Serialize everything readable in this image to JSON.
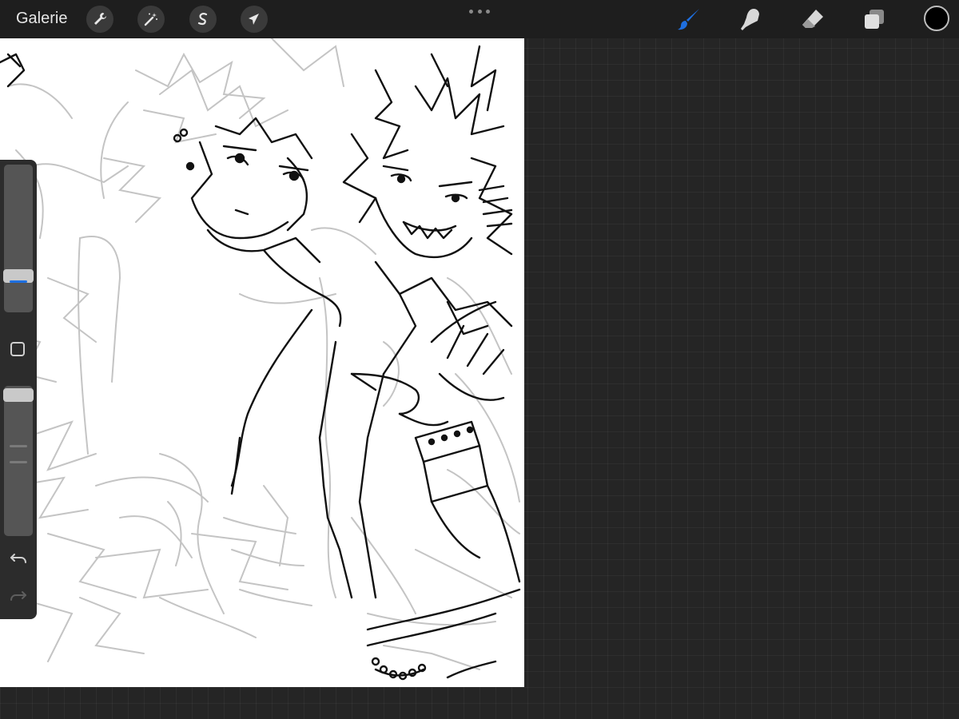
{
  "app": {
    "gallery_label": "Galerie"
  },
  "icons": {
    "actions": "wrench-icon",
    "adjustments": "magic-wand-icon",
    "selection": "selection-s-icon",
    "transform": "arrow-cursor-icon",
    "brush": "brush-icon",
    "smudge": "smudge-finger-icon",
    "eraser": "eraser-icon",
    "layers": "layers-icon",
    "undo": "undo-icon",
    "redo": "redo-icon"
  },
  "colors": {
    "accent": "#1e6fe0",
    "current_color": "#000000"
  },
  "sidebar": {
    "brush_size_level": 0.78,
    "opacity_level": 0.98
  }
}
